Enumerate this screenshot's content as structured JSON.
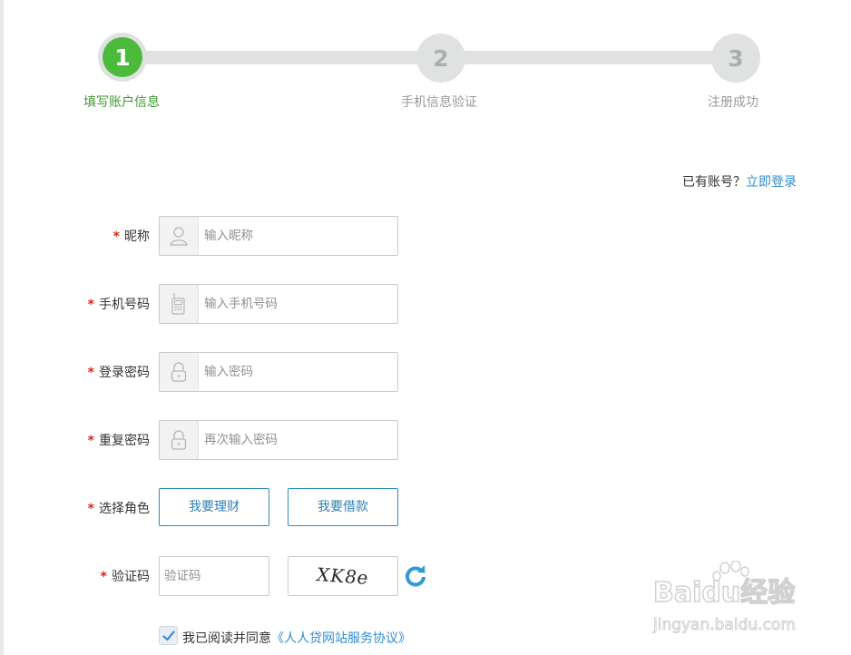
{
  "steps": [
    {
      "number": "1",
      "label": "填写账户信息",
      "state": "active"
    },
    {
      "number": "2",
      "label": "手机信息验证",
      "state": "inactive"
    },
    {
      "number": "3",
      "label": "注册成功",
      "state": "inactive"
    }
  ],
  "login_hint": {
    "text": "已有账号？",
    "link": "立即登录"
  },
  "form": {
    "required_mark": "*",
    "nickname": {
      "label": "昵称",
      "placeholder": "输入昵称",
      "icon": "user-icon"
    },
    "phone": {
      "label": "手机号码",
      "placeholder": "输入手机号码",
      "icon": "mobile-phone-icon"
    },
    "password": {
      "label": "登录密码",
      "placeholder": "输入密码",
      "icon": "lock-icon"
    },
    "repeat_password": {
      "label": "重复密码",
      "placeholder": "再次输入密码",
      "icon": "lock-icon"
    },
    "role": {
      "label": "选择角色",
      "options": [
        "我要理财",
        "我要借款"
      ]
    },
    "captcha": {
      "label": "验证码",
      "placeholder": "验证码",
      "image_text": "XK8e",
      "refresh_icon": "refresh-icon"
    }
  },
  "agreement": {
    "checked": true,
    "text": "我已阅读并同意",
    "link": "《人人贷网站服务协议》"
  },
  "watermark": {
    "brand": "Baidu经验",
    "url": "jingyan.baidu.com"
  },
  "colors": {
    "active_step": "#4cbb3c",
    "inactive_step": "#dfe2e1",
    "link": "#2e8ccf",
    "required": "#d9251c",
    "role_border": "#2f8bb9"
  }
}
